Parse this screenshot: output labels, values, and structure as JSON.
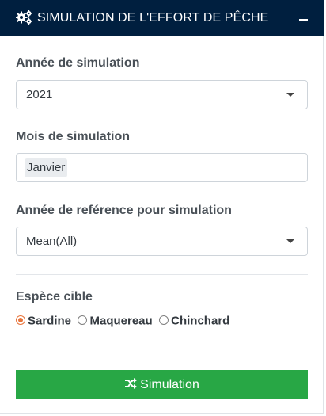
{
  "header": {
    "title": "SIMULATION DE L'EFFORT DE PÊCHE",
    "icon": "gears-icon",
    "collapse_icon": "minus-icon",
    "background": "#001f3f"
  },
  "year_field": {
    "label": "Année de simulation",
    "value": "2021"
  },
  "month_field": {
    "label": "Mois de simulation",
    "selected_tag": "Janvier"
  },
  "reference_field": {
    "label": "Année de reférence pour simulation",
    "value": "Mean(All)"
  },
  "species": {
    "label": "Espèce cible",
    "options": [
      {
        "label": "Sardine",
        "checked": true
      },
      {
        "label": "Maquereau",
        "checked": false
      },
      {
        "label": "Chinchard",
        "checked": false
      }
    ],
    "accent": "#e8743b"
  },
  "run_button": {
    "label": "Simulation",
    "icon": "shuffle-icon",
    "color": "#28a745"
  }
}
